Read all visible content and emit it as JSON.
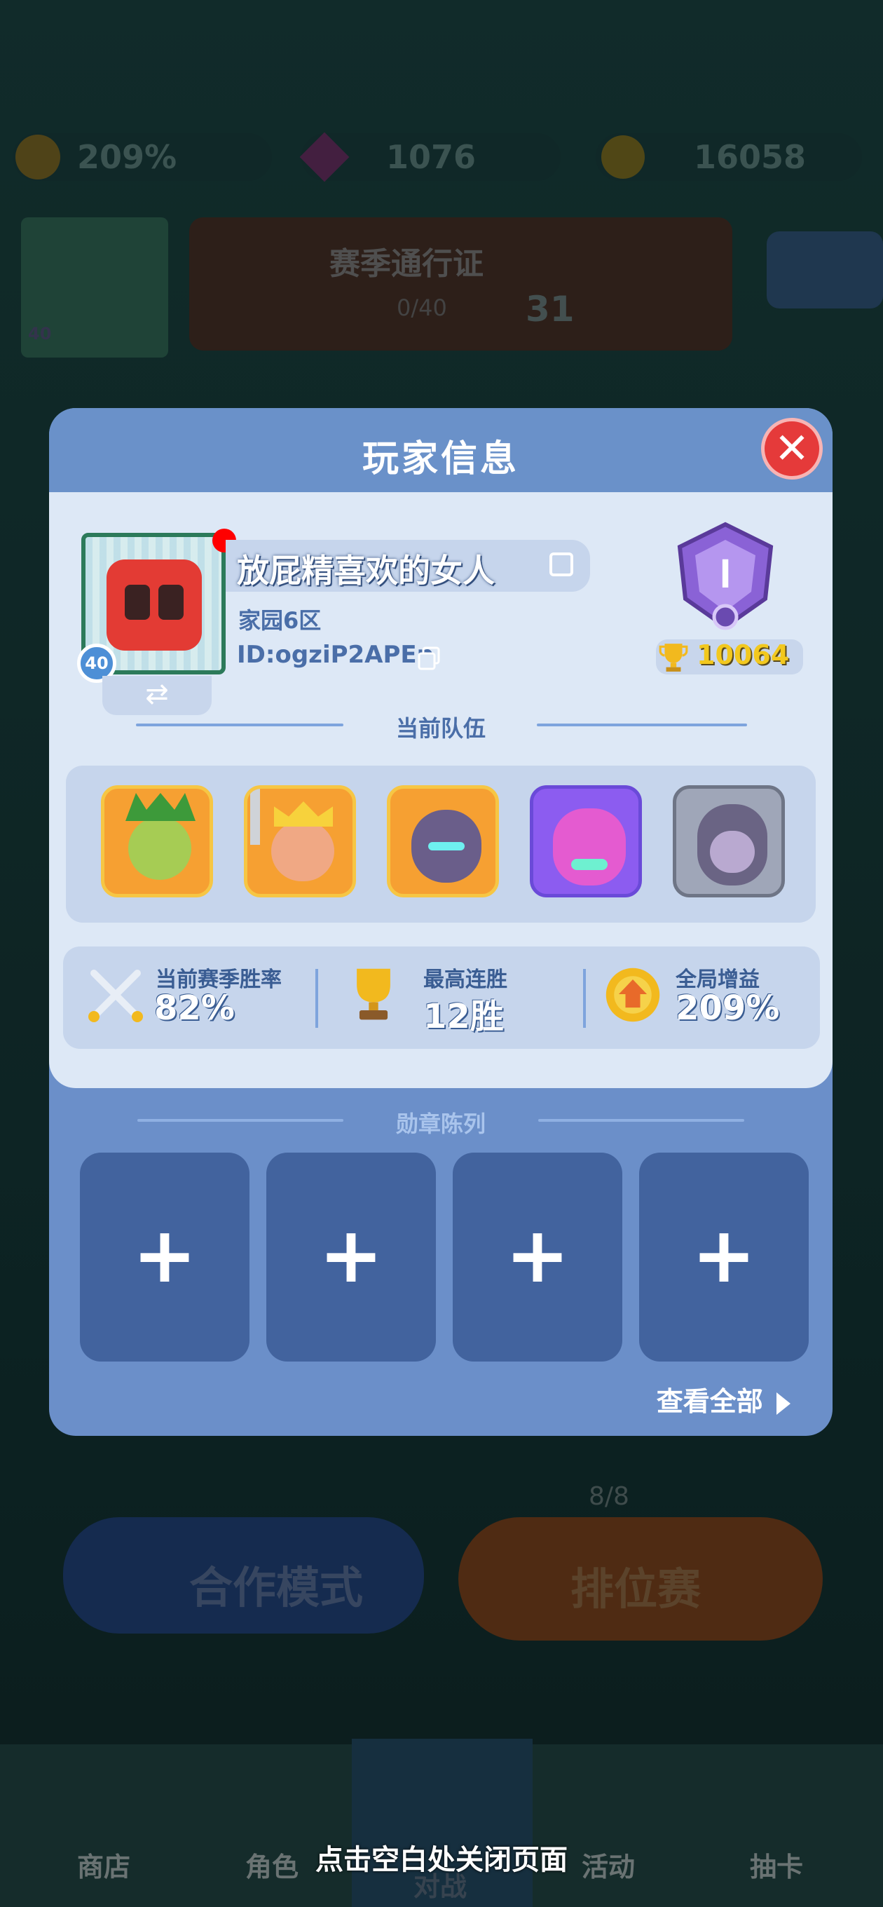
{
  "top_bar": {
    "boost_value": "209%",
    "gems": "1076",
    "coins": "16058"
  },
  "background": {
    "pass_title": "赛季通行证",
    "pass_progress": "0/40",
    "pass_level": "31",
    "avatar_level": "40",
    "coop_mode": "合作模式",
    "ranked_mode": "排位赛",
    "ticket_count": "8/8"
  },
  "modal": {
    "title": "玩家信息",
    "close_icon": "close-icon"
  },
  "player": {
    "name": "放屁精喜欢的女人",
    "zone": "家园6区",
    "id": "ID:ogziP2APEp",
    "level": "40",
    "trophies": "10064",
    "rank_letter": "I"
  },
  "team": {
    "title": "当前队伍",
    "heroes": [
      {
        "name": "hero-goblin-king",
        "bg": "#f6a032"
      },
      {
        "name": "hero-crown-warrior",
        "bg": "#f6a032"
      },
      {
        "name": "hero-dark-knight",
        "bg": "#f6a032"
      },
      {
        "name": "hero-pink-brute",
        "bg": "#8c5cf0"
      },
      {
        "name": "hero-shadow-girl",
        "bg": "#9fa6b8"
      }
    ]
  },
  "stats": {
    "win_rate_label": "当前赛季胜率",
    "win_rate_value": "82%",
    "streak_label": "最高连胜",
    "streak_value": "12胜",
    "global_boost_label": "全局增益",
    "global_boost_value": "209%"
  },
  "medals": {
    "title": "勋章陈列",
    "slots": [
      "+",
      "+",
      "+",
      "+"
    ],
    "view_all": "查看全部"
  },
  "nav": {
    "shop": "商店",
    "character": "角色",
    "battle": "对战",
    "events": "活动",
    "gacha": "抽卡"
  },
  "hint": "点击空白处关闭页面"
}
